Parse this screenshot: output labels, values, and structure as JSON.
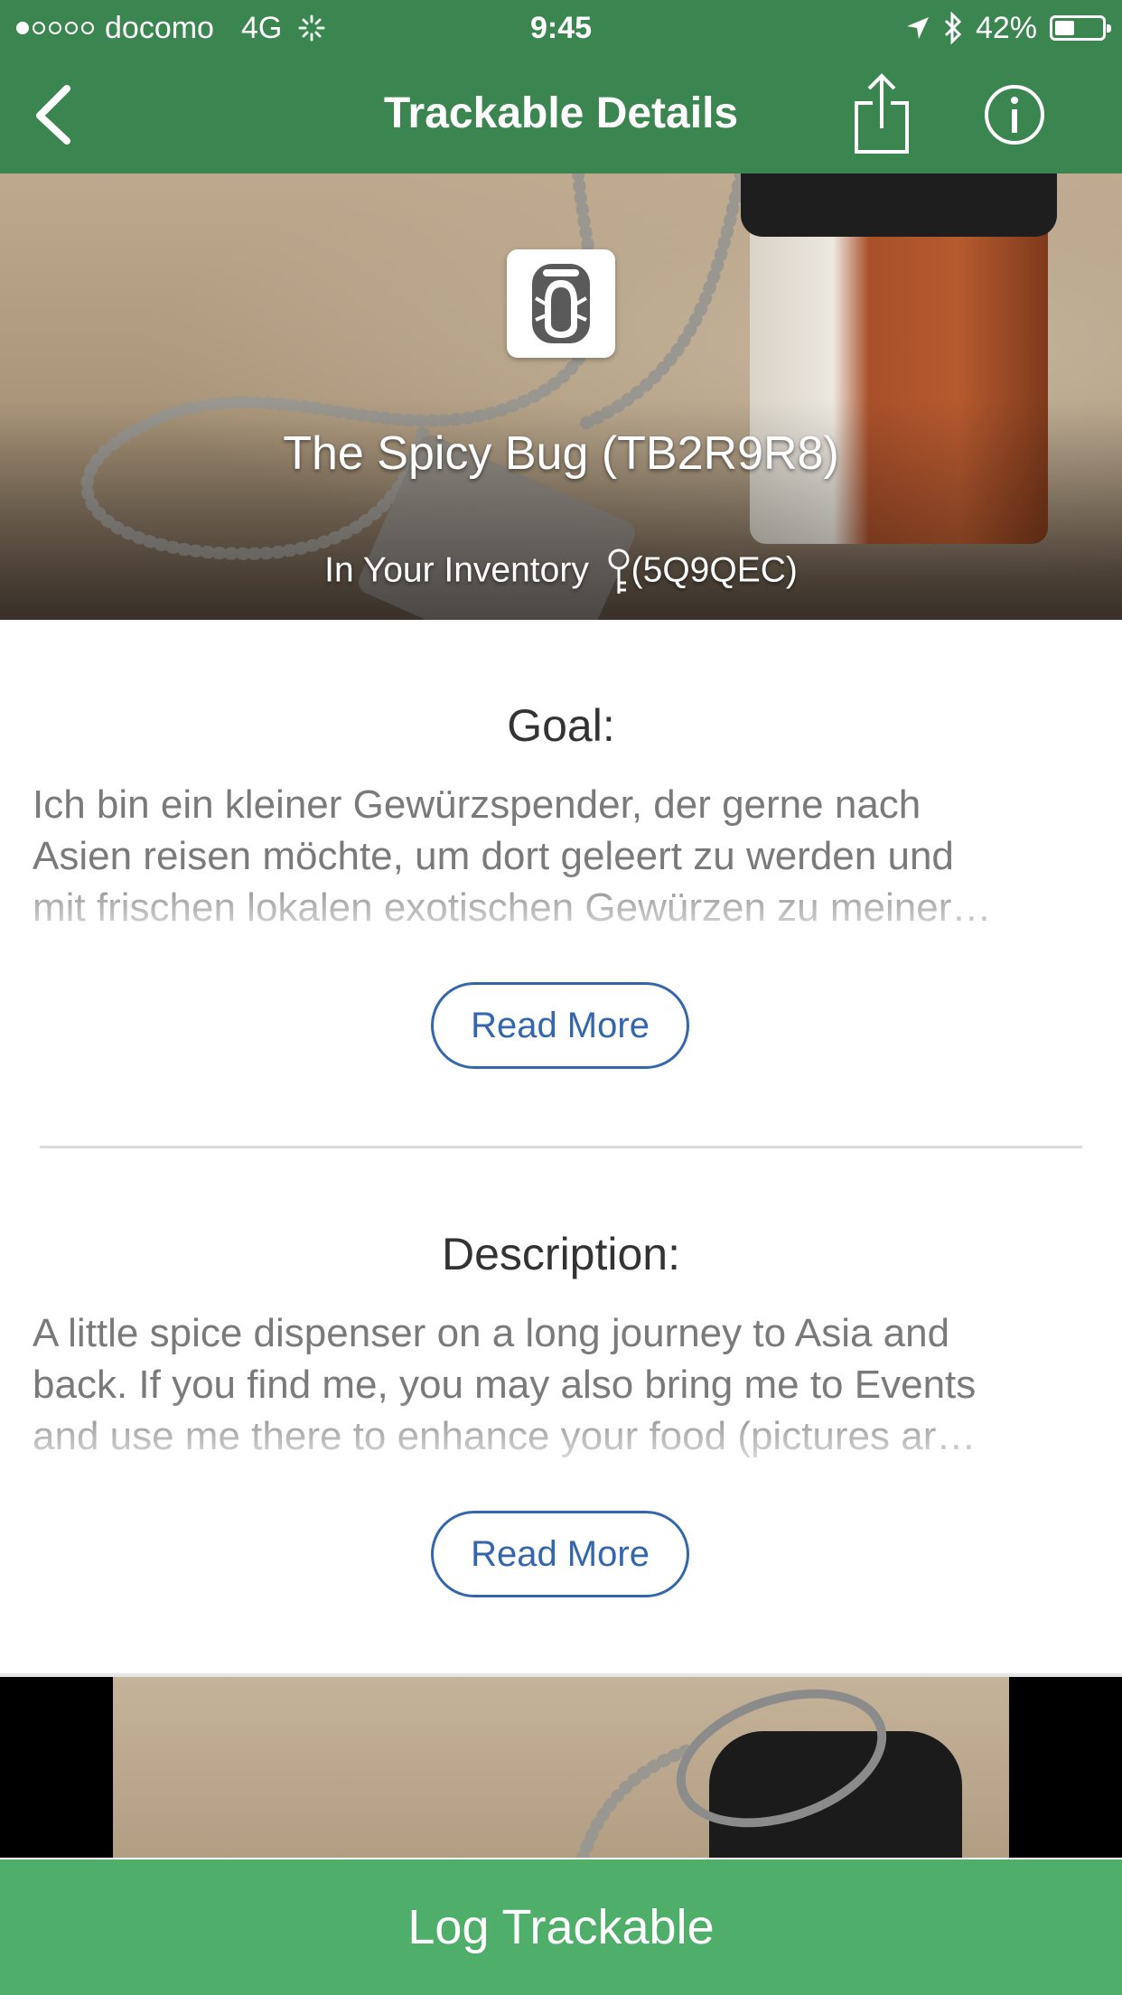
{
  "status_bar": {
    "carrier": "docomo",
    "network": "4G",
    "time": "9:45",
    "battery": "42%",
    "battery_level": 0.42,
    "signal_bars": 1
  },
  "nav": {
    "title": "Trackable Details"
  },
  "hero": {
    "title": "The Spicy Bug (TB2R9R8)",
    "status_text": "In Your Inventory",
    "tracking_code": "(5Q9QEC)"
  },
  "goal": {
    "heading": "Goal:",
    "lines": [
      "Ich bin ein kleiner Gewürzspender, der gerne nach",
      "Asien reisen möchte, um dort geleert zu werden und",
      "mit frischen lokalen exotischen Gewürzen zu meiner…"
    ],
    "read_more": "Read More"
  },
  "description": {
    "heading": "Description:",
    "lines": [
      "A little spice dispenser on a long journey to Asia and",
      "back. If you find me, you may also bring me to Events",
      "and use me there to enhance your food (pictures ar…"
    ],
    "read_more": "Read More"
  },
  "footer": {
    "log_button": "Log Trackable"
  },
  "colors": {
    "nav_green": "#3b8650",
    "button_green": "#4eae6a",
    "link_blue": "#3466ad"
  },
  "icons": [
    "back-chevron-icon",
    "share-icon",
    "info-icon",
    "travel-bug-icon",
    "key-icon",
    "location-arrow-icon",
    "bluetooth-icon",
    "activity-spinner-icon",
    "battery-icon"
  ]
}
